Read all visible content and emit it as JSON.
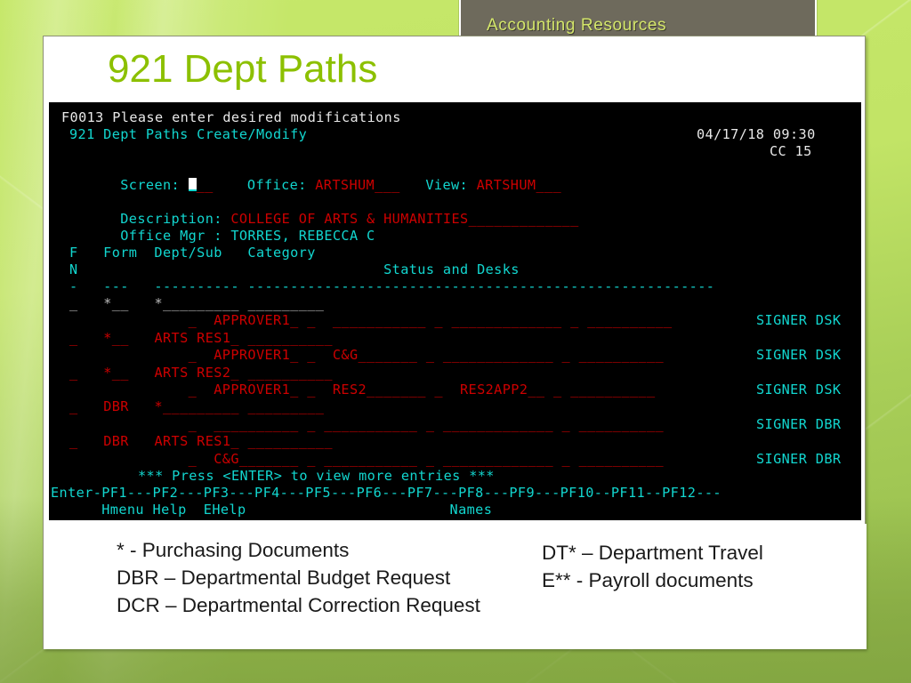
{
  "slide": {
    "banner_label": "Accounting Resources",
    "title": "921 Dept Paths"
  },
  "terminal": {
    "message_line": "F0013 Please enter desired modifications",
    "screen_title": "921 Dept Paths Create/Modify",
    "date": "04/17/18 09:30",
    "cc": "CC 15",
    "fields": {
      "screen_label": "Screen:",
      "screen_value": "",
      "screen_blank": "__",
      "office_label": "Office:",
      "office_value": "ARTSHUM",
      "office_fill": "___",
      "view_label": "View:",
      "view_value": "ARTSHUM",
      "view_fill": "___",
      "description_label": "Description:",
      "description_value": "COLLEGE OF ARTS & HUMANITIES",
      "description_fill": "_____________",
      "office_mgr_label": "Office Mgr :",
      "office_mgr_value": "TORRES, REBECCA C"
    },
    "headers": {
      "line1": "F   Form  Dept/Sub   Category",
      "line2": "N                                    Status and Desks",
      "rule": "-   ---   ---------- -------------------------------------------------------"
    },
    "rows": [
      {
        "fn": "_",
        "form": "*__",
        "deptsub": "*_________",
        "category": "_________",
        "color": "gy"
      },
      {
        "cont": "              _  APPROVER1_ _  ___________ _ _____________ _ __________",
        "signer": "SIGNER DSK",
        "color": "rd"
      },
      {
        "fn": "_",
        "form": "*__",
        "deptsub": "ARTS RES1_",
        "category": "__________",
        "color": "rd"
      },
      {
        "cont": "              _  APPROVER1_ _  C&G_______ _ _____________ _ __________",
        "signer": "SIGNER DSK",
        "color": "rd"
      },
      {
        "fn": "_",
        "form": "*__",
        "deptsub": "ARTS RES2_",
        "category": "__________",
        "color": "rd"
      },
      {
        "cont": "              _  APPROVER1_ _  RES2_______ _  RES2APP2__ _ __________",
        "signer": "SIGNER DSK",
        "color": "rd"
      },
      {
        "fn": "_",
        "form": "DBR",
        "deptsub": "*_________",
        "category": "_________",
        "color": "rd"
      },
      {
        "cont": "              _  __________ _ ___________ _ _____________ _ __________",
        "signer": "SIGNER DBR",
        "color": "rd"
      },
      {
        "fn": "_",
        "form": "DBR",
        "deptsub": "ARTS RES1_",
        "category": "__________",
        "color": "rd"
      },
      {
        "cont": "              _  C&G_______ _ ___________ _ _____________ _ __________",
        "signer": "SIGNER DBR",
        "color": "rd"
      }
    ],
    "more_entries": "*** Press <ENTER> to view more entries ***",
    "pf_line": "Enter-PF1---PF2---PF3---PF4---PF5---PF6---PF7---PF8---PF9---PF10--PF11--PF12---",
    "pf_labels": "      Hmenu Help  EHelp                        Names"
  },
  "legend": {
    "left": [
      "* - Purchasing Documents",
      "DBR – Departmental Budget Request",
      "DCR – Departmental Correction Request"
    ],
    "right": [
      "DT* – Department Travel",
      "E** - Payroll documents"
    ]
  },
  "colors": {
    "slide_green": "#9fc050",
    "title_green": "#8cc000",
    "banner_bg": "#6e6a5c",
    "banner_text": "#d4e66a",
    "terminal_bg": "#000000",
    "terminal_cyan": "#12d6cf",
    "terminal_red": "#cc0000",
    "terminal_white": "#e8e8e8"
  }
}
